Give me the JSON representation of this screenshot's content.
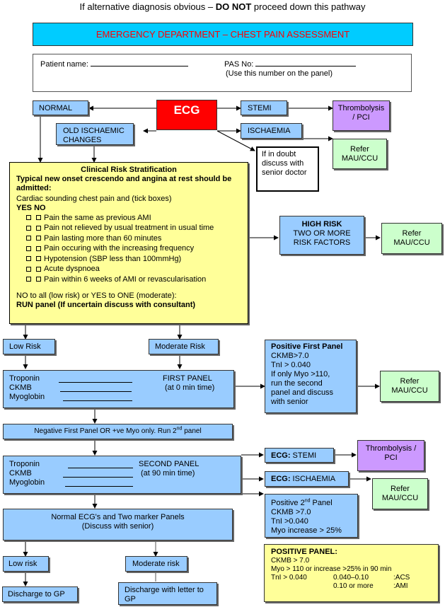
{
  "header": {
    "warning_prefix": "If alternative diagnosis obvious – ",
    "warning_bold": "DO NOT",
    "warning_suffix": " proceed down this pathway",
    "title": "EMERGENCY DEPARTMENT – CHEST PAIN ASSESSMENT",
    "title_color": "#ff0000",
    "title_bg": "#00ccff"
  },
  "patient": {
    "name_label": "Patient name:",
    "name_value": "",
    "pas_label": "PAS No:",
    "pas_value": "",
    "pas_note": "(Use this number on the panel)"
  },
  "ecg": {
    "label": "ECG",
    "color": "#ff0000",
    "normal": "NORMAL",
    "old_ischaemic": "OLD ISCHAEMIC CHANGES",
    "stemi": "STEMI",
    "ischaemia": "ISCHAEMIA",
    "thrombolysis": "Thrombolysis / PCI",
    "refer": "Refer MAU/CCU",
    "doubt": "If in doubt discuss with senior doctor"
  },
  "risk_strat": {
    "title": "Clinical Risk Stratification",
    "subtitle": "Typical new onset crescendo and angina at rest should be admitted:",
    "intro": "Cardiac sounding chest pain and (tick boxes)",
    "yes_no": "YES NO",
    "items": [
      {
        "label": "Pain the same as previous AMI",
        "yes": false,
        "no": false
      },
      {
        "label": "Pain not relieved by usual treatment in usual time",
        "yes": false,
        "no": false
      },
      {
        "label": "Pain lasting more than 60 minutes",
        "yes": false,
        "no": false
      },
      {
        "label": "Pain occuring with the increasing frequency",
        "yes": false,
        "no": false
      },
      {
        "label": "Hypotension (SBP less than 100mmHg)",
        "yes": false,
        "no": false
      },
      {
        "label": "Acute dyspnoea",
        "yes": false,
        "no": false
      },
      {
        "label": "Pain within 6 weeks of AMI or revascularisation",
        "yes": false,
        "no": false
      }
    ],
    "footer_line1": "NO to all (low risk) or YES to ONE (moderate):",
    "footer_line2": "RUN  panel (If uncertain discuss with consultant)"
  },
  "high_risk": {
    "title": "HIGH RISK",
    "line1": "TWO OR MORE",
    "line2": "RISK FACTORS",
    "refer": "Refer MAU/CCU"
  },
  "first_stage": {
    "low_risk": "Low Risk",
    "moderate_risk": "Moderate Risk",
    "panel_title": "FIRST PANEL",
    "panel_time": "(at 0 min time)",
    "markers": [
      "Troponin",
      "CKMB",
      "Myoglobin"
    ],
    "positive_title": "Positive First Panel",
    "positive_lines": [
      "CKMB>7.0",
      "TnI > 0.040",
      "If only Myo >110,",
      "run the second",
      "panel and discuss",
      "with senior"
    ],
    "refer": "Refer MAU/CCU",
    "negative_text": "Negative First Panel OR +ve Myo only. Run 2",
    "negative_sup": "nd",
    "negative_suffix": " panel"
  },
  "second_stage": {
    "panel_title": "SECOND PANEL",
    "panel_time": "(at 90 min time)",
    "markers": [
      "Troponin",
      "CKMB",
      "Myoglobin"
    ],
    "ecg_stemi_bold": "ECG:",
    "ecg_stemi": " STEMI",
    "ecg_isch_bold": "ECG:",
    "ecg_isch": " ISCHAEMIA",
    "thrombolysis": "Thrombolysis / PCI",
    "refer": "Refer MAU/CCU",
    "positive_prefix": "Positive 2",
    "positive_sup": "nd",
    "positive_suffix": " Panel",
    "positive_lines": [
      "CKMB >7.0",
      "TnI >0.040",
      "Myo increase > 25%"
    ],
    "normal_line1": "Normal ECG's and Two marker Panels",
    "normal_line2": "(Discuss with senior)"
  },
  "outcome": {
    "low_risk": "Low risk",
    "moderate_risk": "Moderate risk",
    "discharge_gp": "Discharge to GP",
    "discharge_letter": "Discharge with letter to GP"
  },
  "positive_panel_key": {
    "title": "POSITIVE PANEL:",
    "line1": "CKMB > 7.0",
    "line2": "Myo > 110 or increase >25% in 90 min",
    "tni_label": "TnI > 0.040",
    "ranges": [
      {
        "range": "0.040–0.10",
        "meaning": ":ACS"
      },
      {
        "range": "0.10 or more",
        "meaning": ":AMI"
      }
    ]
  }
}
